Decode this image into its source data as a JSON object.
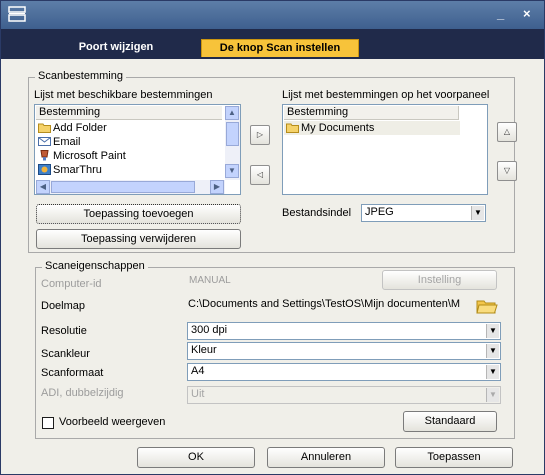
{
  "window": {
    "minimize_glyph": "_",
    "close_glyph": "×"
  },
  "tabs": [
    {
      "label": "Poort wijzigen",
      "active": false
    },
    {
      "label": "De knop Scan instellen",
      "active": true
    }
  ],
  "scan_destination": {
    "group_title": "Scanbestemming",
    "available": {
      "title": "Lijst met beschikbare bestemmingen",
      "column": "Bestemming",
      "items": [
        {
          "label": "Add Folder",
          "icon": "folder-icon"
        },
        {
          "label": "Email",
          "icon": "email-icon"
        },
        {
          "label": "Microsoft Paint",
          "icon": "paint-icon"
        },
        {
          "label": "SmarThru",
          "icon": "smarthru-icon"
        }
      ]
    },
    "front_panel": {
      "title": "Lijst met bestemmingen op het voorpaneel",
      "column": "Bestemming",
      "items": [
        {
          "label": "My Documents",
          "icon": "folder-icon"
        }
      ]
    },
    "add_button": "Toepassing toevoegen",
    "remove_button": "Toepassing verwijderen",
    "file_format_label": "Bestandsindel",
    "file_format_value": "JPEG"
  },
  "scan_properties": {
    "group_title": "Scaneigenschappen",
    "computer_id_label": "Computer-id",
    "computer_id_value": "MANUAL",
    "setting_button": "Instelling",
    "target_folder_label": "Doelmap",
    "target_folder_value": "C:\\Documents and Settings\\TestOS\\Mijn documenten\\M",
    "resolution_label": "Resolutie",
    "resolution_value": "300 dpi",
    "color_label": "Scankleur",
    "color_value": "Kleur",
    "format_label": "Scanformaat",
    "format_value": "A4",
    "adf_label": "ADI, dubbelzijdig",
    "adf_value": "Uit",
    "preview_label": "Voorbeeld weergeven",
    "preview_checked": false,
    "default_button": "Standaard"
  },
  "footer": {
    "ok": "OK",
    "cancel": "Annuleren",
    "apply": "Toepassen"
  }
}
